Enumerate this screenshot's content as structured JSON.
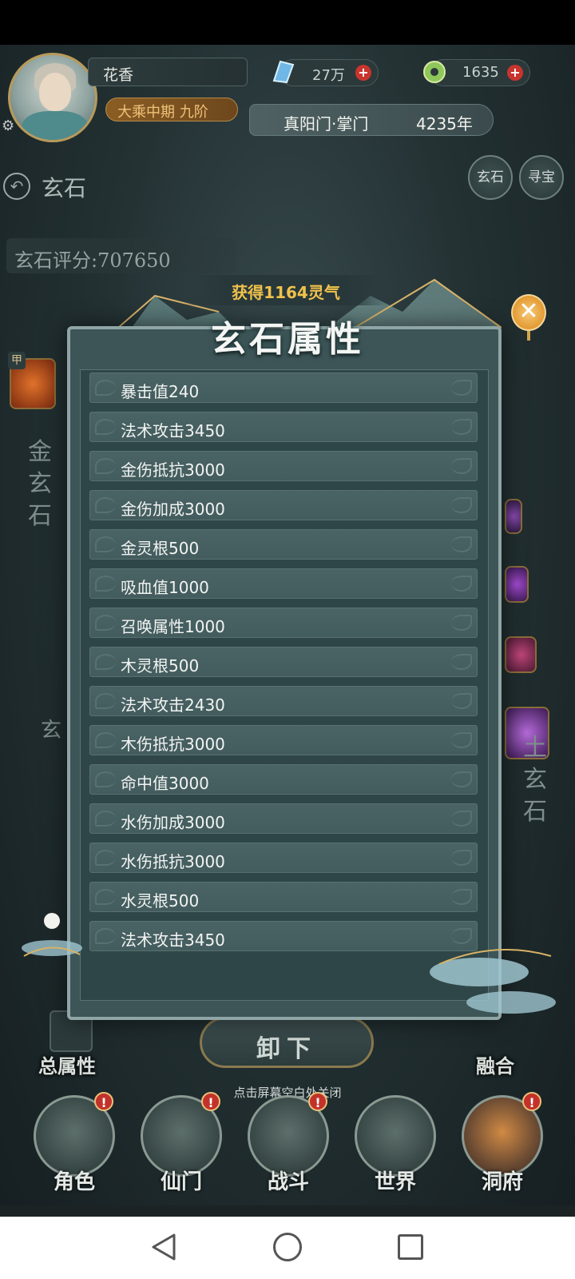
{
  "header": {
    "player_name": "花香",
    "cultivation_rank": "大乘中期 九阶",
    "currency_spirit_stone": "27万",
    "currency_jade": "1635",
    "sect": "真阳门·掌门",
    "year": "4235年"
  },
  "page": {
    "back_title": "玄石",
    "tab_buttons": [
      "玄石",
      "寻宝"
    ],
    "score_label": "玄石评分:707650",
    "left_slot_label": "金玄石",
    "left_slot_tag": "甲",
    "right_slot_label": "土玄石",
    "left_partial_label": "玄",
    "total_attr_label": "总属性",
    "fuse_label": "融合",
    "unload_label": "卸下",
    "tap_hint": "点击屏幕空白处关闭"
  },
  "modal": {
    "gain_banner": "获得1164灵气",
    "title": "玄石属性",
    "close_glyph": "✕",
    "attributes": [
      "暴击值240",
      "法术攻击3450",
      "金伤抵抗3000",
      "金伤加成3000",
      "金灵根500",
      "吸血值1000",
      "召唤属性1000",
      "木灵根500",
      "法术攻击2430",
      "木伤抵抗3000",
      "命中值3000",
      "水伤加成3000",
      "水伤抵抗3000",
      "水灵根500",
      "法术攻击3450"
    ]
  },
  "bottom_nav": {
    "items": [
      {
        "label": "角色",
        "badge": "!",
        "icon": "character-icon"
      },
      {
        "label": "仙门",
        "badge": "!",
        "icon": "sect-gate-icon"
      },
      {
        "label": "战斗",
        "badge": "!",
        "icon": "battle-sword-icon"
      },
      {
        "label": "世界",
        "badge": "",
        "icon": "world-landscape-icon"
      },
      {
        "label": "洞府",
        "badge": "!",
        "icon": "cave-dwelling-icon"
      }
    ]
  },
  "colors": {
    "gold_text": "#f0c24b",
    "badge_red": "#c3322a",
    "modal_row": "#4a6365"
  },
  "system_nav": {
    "icons": [
      "back-triangle-icon",
      "home-circle-icon",
      "recent-square-icon"
    ]
  }
}
